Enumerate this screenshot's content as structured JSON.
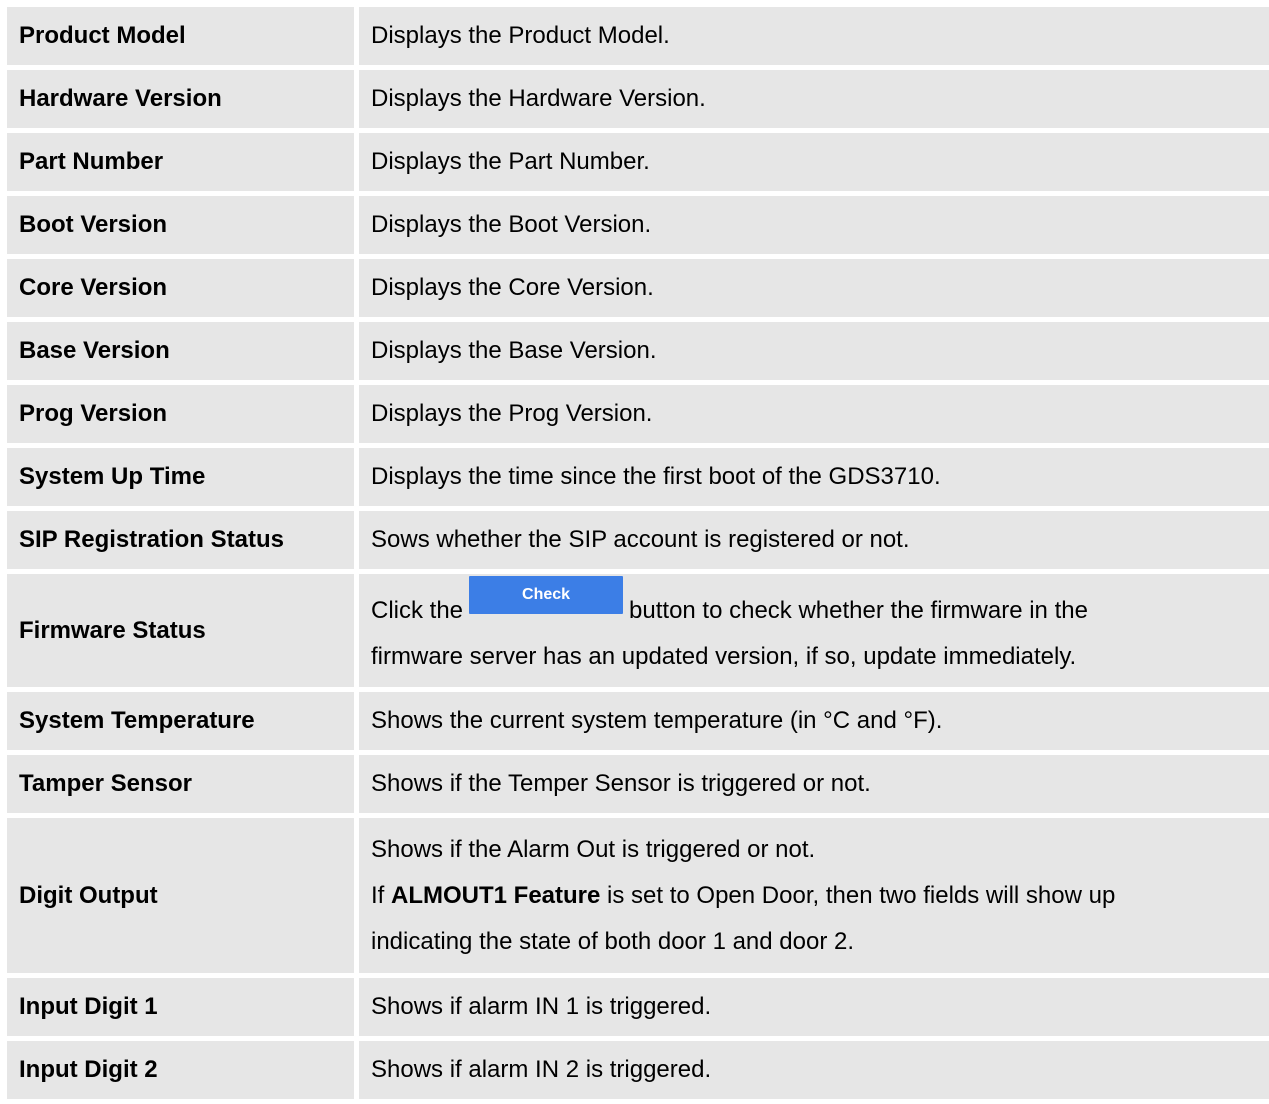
{
  "rows": [
    {
      "label": "Product Model",
      "desc": "Displays the Product Model."
    },
    {
      "label": "Hardware Version",
      "desc": "Displays the Hardware Version."
    },
    {
      "label": "Part Number",
      "desc": "Displays the Part Number."
    },
    {
      "label": "Boot Version",
      "desc": "Displays the Boot Version."
    },
    {
      "label": "Core Version",
      "desc": "Displays the Core Version."
    },
    {
      "label": "Base Version",
      "desc": "Displays the Base Version."
    },
    {
      "label": "Prog Version",
      "desc": "Displays the Prog Version."
    },
    {
      "label": "System Up Time",
      "desc": "Displays the time since the first boot of the GDS3710."
    },
    {
      "label": "SIP Registration Status",
      "desc": "Sows whether the SIP account is registered or not."
    },
    {
      "label": "Firmware Status",
      "desc_pre": "Click the",
      "button_label": "Check",
      "desc_post": "button to check whether the firmware in the",
      "desc_line2": "firmware server has an updated version, if so, update immediately."
    },
    {
      "label": "System Temperature",
      "desc": "Shows the current system temperature (in °C and °F)."
    },
    {
      "label": "Tamper Sensor",
      "desc": "Shows if the Temper Sensor is triggered or not."
    },
    {
      "label": "Digit Output",
      "desc_line1": "Shows if the Alarm Out is triggered or not.",
      "desc_line2_pre": "If",
      "desc_line2_bold": "ALMOUT1 Feature",
      "desc_line2_post": "is set to Open Door, then two fields will show up",
      "desc_line3": "indicating the state of both door 1 and door 2."
    },
    {
      "label": "Input Digit 1",
      "desc": "Shows if alarm IN 1 is triggered."
    },
    {
      "label": "Input Digit 2",
      "desc": "Shows if alarm IN 2 is triggered."
    }
  ]
}
